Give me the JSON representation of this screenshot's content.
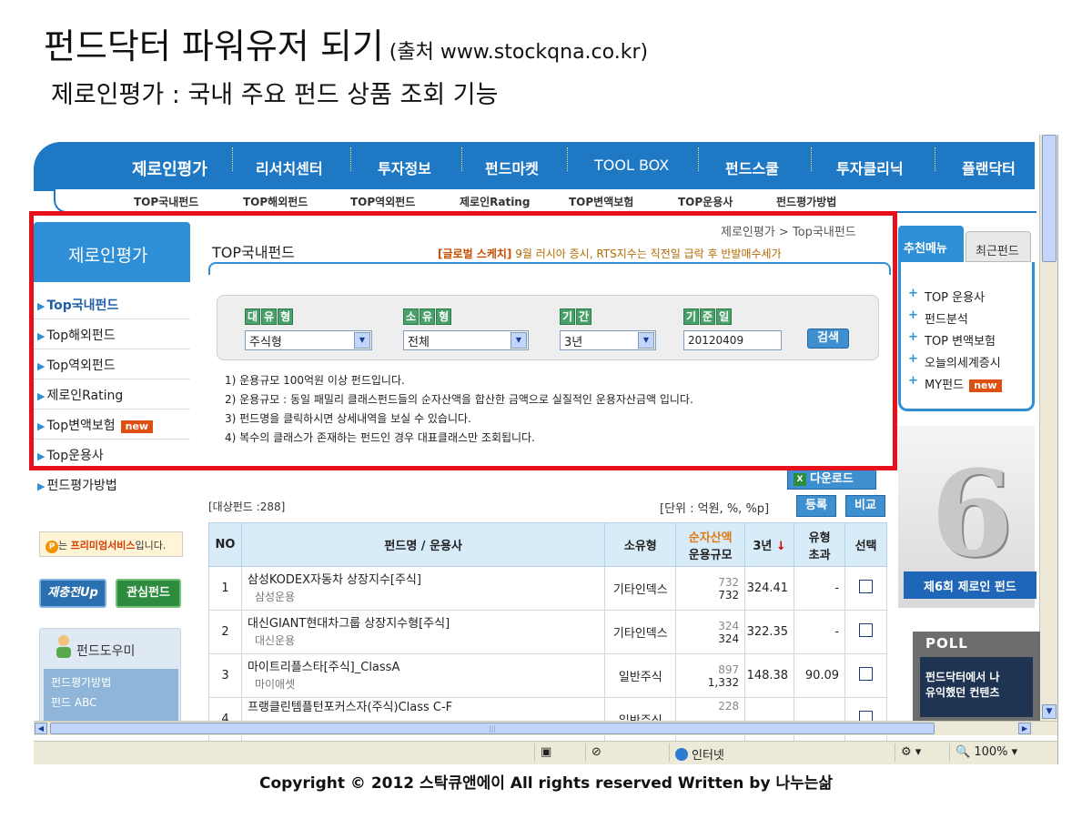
{
  "slide": {
    "title": "펀드닥터 파워유저 되기",
    "source": "(출처 www.stockqna.co.kr)",
    "subtitle": "제로인평가 : 국내 주요 펀드 상품 조회 기능",
    "copyright": "Copyright © 2012 스탁큐앤에이 All rights reserved Written by 나누는삶"
  },
  "gnb": [
    "제로인평가",
    "리서치센터",
    "투자정보",
    "펀드마켓",
    "TOOL BOX",
    "펀드스쿨",
    "투자클리닉",
    "플랜닥터"
  ],
  "lnb": [
    "TOP국내펀드",
    "TOP해외펀드",
    "TOP역외펀드",
    "제로인Rating",
    "TOP변액보험",
    "TOP운용사",
    "펀드평가방법"
  ],
  "sidebar": {
    "title": "제로인평가",
    "items": [
      {
        "label": "Top국내펀드",
        "badge": ""
      },
      {
        "label": "Top해외펀드",
        "badge": ""
      },
      {
        "label": "Top역외펀드",
        "badge": ""
      },
      {
        "label": "제로인Rating",
        "badge": ""
      },
      {
        "label": "Top변액보험",
        "badge": "new"
      },
      {
        "label": "Top운용사",
        "badge": ""
      },
      {
        "label": "펀드평가방법",
        "badge": ""
      }
    ],
    "premium_prefix": "는 ",
    "premium_bold": "프리미엄서비스",
    "premium_suffix": "입니다.",
    "btn_charge": "재충전Up",
    "btn_fav": "관심펀드",
    "helper_title": "펀드도우미",
    "helper_links": [
      "펀드평가방법",
      "펀드 ABC"
    ]
  },
  "main": {
    "breadcrumb": "제로인평가 > Top국내펀드",
    "heading": "TOP국내펀드",
    "ticker_tag": "[글로벌 스케치]",
    "ticker_text": " 9월 러시아 증시, RTS지수는 직전일 급락 후 반발매수세가",
    "filters": {
      "type_label": [
        "대",
        "유",
        "형"
      ],
      "type_value": "주식형",
      "subtype_label": [
        "소",
        "유",
        "형"
      ],
      "subtype_value": "전체",
      "period_label": [
        "기",
        "간"
      ],
      "period_value": "3년",
      "date_label": [
        "기",
        "준",
        "일"
      ],
      "date_value": "20120409",
      "search_button": "검색"
    },
    "notes": [
      "1) 운용규모 100억원 이상 펀드입니다.",
      "2) 운용규모 : 동일 패밀리 클래스펀드들의 순자산액을 합산한 금액으로 실질적인 운용자산금액 입니다.",
      "3) 펀드명을 클릭하시면 상세내역을 보실 수 있습니다.",
      "4) 복수의 클래스가 존재하는 펀드인 경우 대표클래스만 조회됩니다."
    ],
    "download_label": "다운로드",
    "count_text": "[대상펀드 :288]",
    "unit_text": "[단위 : 억원, %, %p]",
    "register_button": "등록",
    "compare_button": "비교",
    "table": {
      "headers": {
        "no": "NO",
        "name": "펀드명 / 운용사",
        "type": "소유형",
        "nav_top": "순자산액",
        "nav_bottom": "운용규모",
        "period": "3년",
        "period_arrow": "↓",
        "excess_top": "유형",
        "excess_bottom": "초과",
        "select": "선택"
      },
      "rows": [
        {
          "no": "1",
          "name": "삼성KODEX자동차 상장지수[주식]",
          "manager": "삼성운용",
          "type": "기타인덱스",
          "nav": "732",
          "aum": "732",
          "ret": "324.41",
          "excess": "-"
        },
        {
          "no": "2",
          "name": "대신GIANT현대차그룹 상장지수형[주식]",
          "manager": "대신운용",
          "type": "기타인덱스",
          "nav": "324",
          "aum": "324",
          "ret": "322.35",
          "excess": "-"
        },
        {
          "no": "3",
          "name": "마이트리플스타[주식]_ClassA",
          "manager": "마이애셋",
          "type": "일반주식",
          "nav": "897",
          "aum": "1,332",
          "ret": "148.38",
          "excess": "90.09"
        },
        {
          "no": "4",
          "name": "프랭클린템플턴포커스자(주식)Class C-F",
          "manager": "",
          "type": "일반주식",
          "nav": "228",
          "aum": "",
          "ret": "",
          "excess": ""
        }
      ]
    }
  },
  "right": {
    "tab_recommend": "추천메뉴",
    "tab_recent": "최근펀드",
    "items": [
      "TOP 운용사",
      "펀드분석",
      "TOP 변액보험",
      "오늘의세계증시",
      "MY펀드"
    ],
    "my_badge": "new",
    "ad_ribbon": "제6회 제로인 펀드",
    "ad_number": "6",
    "poll_title": "POLL",
    "poll_line1": "펀드닥터에서 나",
    "poll_line2": "유익했던 컨텐츠"
  },
  "statusbar": {
    "zone": "인터넷",
    "zoom": "100%"
  },
  "colors": {
    "brand_blue": "#1f78c4",
    "highlight_red": "#e8101a",
    "new_badge": "#e04f12"
  }
}
